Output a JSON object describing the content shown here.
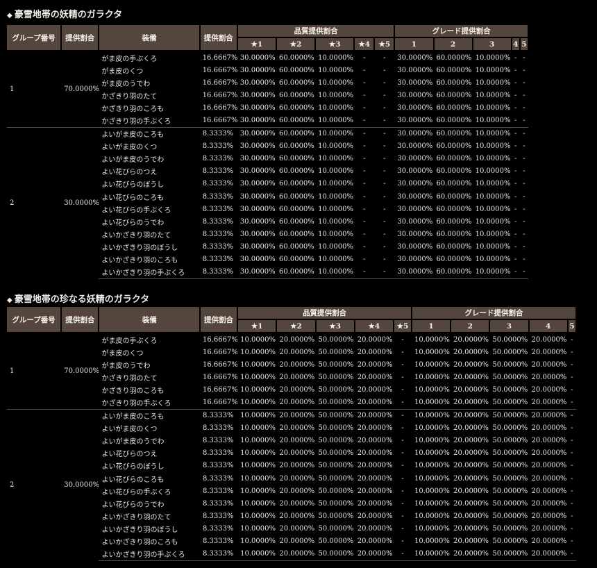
{
  "headers": {
    "group": "グループ番号",
    "rate": "提供割合",
    "equip": "装備",
    "quality": "品質提供割合",
    "grade": "グレード提供割合",
    "stars": [
      "★1",
      "★2",
      "★3",
      "★4",
      "★5"
    ],
    "grades": [
      "1",
      "2",
      "3",
      "4",
      "5"
    ]
  },
  "tables": [
    {
      "title": "豪雪地帯の妖精のガラクタ",
      "groups": [
        {
          "id": "1",
          "rate": "70.0000%",
          "items": [
            {
              "name": "がま皮の手ぶくろ",
              "rate": "16.6667%"
            },
            {
              "name": "がま皮のくつ",
              "rate": "16.6667%"
            },
            {
              "name": "がま皮のうでわ",
              "rate": "16.6667%"
            },
            {
              "name": "かざきり羽のたて",
              "rate": "16.6667%"
            },
            {
              "name": "かざきり羽のころも",
              "rate": "16.6667%"
            },
            {
              "name": "かざきり羽の手ぶくろ",
              "rate": "16.6667%"
            }
          ],
          "quality": [
            "30.0000%",
            "60.0000%",
            "10.0000%",
            "-",
            "-"
          ],
          "grade": [
            "30.0000%",
            "60.0000%",
            "10.0000%",
            "-",
            "-"
          ]
        },
        {
          "id": "2",
          "rate": "30.0000%",
          "items": [
            {
              "name": "よいがま皮のころも",
              "rate": "8.3333%"
            },
            {
              "name": "よいがま皮のくつ",
              "rate": "8.3333%"
            },
            {
              "name": "よいがま皮のうでわ",
              "rate": "8.3333%"
            },
            {
              "name": "よい花びらのつえ",
              "rate": "8.3333%"
            },
            {
              "name": "よい花びらのぼうし",
              "rate": "8.3333%"
            },
            {
              "name": "よい花びらのころも",
              "rate": "8.3333%"
            },
            {
              "name": "よい花びらの手ぶくろ",
              "rate": "8.3333%"
            },
            {
              "name": "よい花びらのうでわ",
              "rate": "8.3333%"
            },
            {
              "name": "よいかざきり羽のたて",
              "rate": "8.3333%"
            },
            {
              "name": "よいかざきり羽のぼうし",
              "rate": "8.3333%"
            },
            {
              "name": "よいかざきり羽のころも",
              "rate": "8.3333%"
            },
            {
              "name": "よいかざきり羽の手ぶくろ",
              "rate": "8.3333%"
            }
          ],
          "quality": [
            "30.0000%",
            "60.0000%",
            "10.0000%",
            "-",
            "-"
          ],
          "grade": [
            "30.0000%",
            "60.0000%",
            "10.0000%",
            "-",
            "-"
          ]
        }
      ]
    },
    {
      "title": "豪雪地帯の珍なる妖精のガラクタ",
      "groups": [
        {
          "id": "1",
          "rate": "70.0000%",
          "items": [
            {
              "name": "がま皮の手ぶくろ",
              "rate": "16.6667%"
            },
            {
              "name": "がま皮のくつ",
              "rate": "16.6667%"
            },
            {
              "name": "がま皮のうでわ",
              "rate": "16.6667%"
            },
            {
              "name": "かざきり羽のたて",
              "rate": "16.6667%"
            },
            {
              "name": "かざきり羽のころも",
              "rate": "16.6667%"
            },
            {
              "name": "かざきり羽の手ぶくろ",
              "rate": "16.6667%"
            }
          ],
          "quality": [
            "10.0000%",
            "20.0000%",
            "50.0000%",
            "20.0000%",
            "-"
          ],
          "grade": [
            "10.0000%",
            "20.0000%",
            "50.0000%",
            "20.0000%",
            "-"
          ]
        },
        {
          "id": "2",
          "rate": "30.0000%",
          "items": [
            {
              "name": "よいがま皮のころも",
              "rate": "8.3333%"
            },
            {
              "name": "よいがま皮のくつ",
              "rate": "8.3333%"
            },
            {
              "name": "よいがま皮のうでわ",
              "rate": "8.3333%"
            },
            {
              "name": "よい花びらのつえ",
              "rate": "8.3333%"
            },
            {
              "name": "よい花びらのぼうし",
              "rate": "8.3333%"
            },
            {
              "name": "よい花びらのころも",
              "rate": "8.3333%"
            },
            {
              "name": "よい花びらの手ぶくろ",
              "rate": "8.3333%"
            },
            {
              "name": "よい花びらのうでわ",
              "rate": "8.3333%"
            },
            {
              "name": "よいかざきり羽のたて",
              "rate": "8.3333%"
            },
            {
              "name": "よいかざきり羽のぼうし",
              "rate": "8.3333%"
            },
            {
              "name": "よいかざきり羽のころも",
              "rate": "8.3333%"
            },
            {
              "name": "よいかざきり羽の手ぶくろ",
              "rate": "8.3333%"
            }
          ],
          "quality": [
            "10.0000%",
            "20.0000%",
            "50.0000%",
            "20.0000%",
            "-"
          ],
          "grade": [
            "10.0000%",
            "20.0000%",
            "50.0000%",
            "20.0000%",
            "-"
          ]
        }
      ]
    }
  ]
}
